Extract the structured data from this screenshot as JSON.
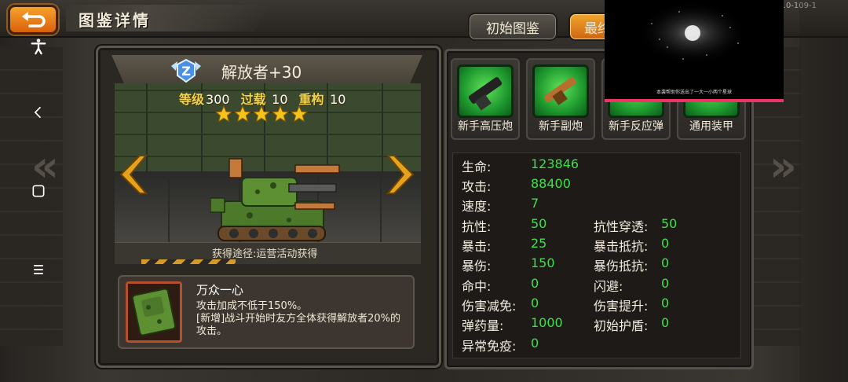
{
  "header": {
    "title": "图鉴详情",
    "btn_initial": "初始图鉴",
    "btn_max": "最终",
    "version": ".0-109-1"
  },
  "unit": {
    "name": "解放者+30",
    "level_label": "等级",
    "level": "300",
    "overload_label": "过载",
    "overload": "10",
    "rebuild_label": "重构",
    "rebuild": "10",
    "stars": 5,
    "source": "获得途径:运营活动获得"
  },
  "skill": {
    "name": "万众一心",
    "desc1": "攻击加成不低于150%。",
    "desc2": "[新增]战斗开始时友方全体获得解放者20%的攻击。"
  },
  "equipment": [
    {
      "label": "新手高压炮"
    },
    {
      "label": "新手副炮"
    },
    {
      "label": "新手反应弹"
    },
    {
      "label": "通用装甲"
    }
  ],
  "stats_left": [
    {
      "label": "生命:",
      "value": "123846"
    },
    {
      "label": "攻击:",
      "value": "88400"
    },
    {
      "label": "速度:",
      "value": "7"
    },
    {
      "label": "抗性:",
      "value": "50"
    },
    {
      "label": "暴击:",
      "value": "25"
    },
    {
      "label": "暴伤:",
      "value": "150"
    },
    {
      "label": "命中:",
      "value": "0"
    },
    {
      "label": "伤害减免:",
      "value": "0"
    },
    {
      "label": "弹药量:",
      "value": "1000"
    },
    {
      "label": "异常免疫:",
      "value": "0"
    }
  ],
  "stats_right": [
    {
      "label": "抗性穿透:",
      "value": "50"
    },
    {
      "label": "暴击抵抗:",
      "value": "0"
    },
    {
      "label": "暴伤抵抗:",
      "value": "0"
    },
    {
      "label": "闪避:",
      "value": "0"
    },
    {
      "label": "伤害提升:",
      "value": "0"
    },
    {
      "label": "初始护盾:",
      "value": "0"
    }
  ],
  "video": {
    "caption": "本袭帮助你送出了一大一小两个星球"
  },
  "colors": {
    "stat_value": "#40e04b",
    "star": "#f3c21b",
    "accent_orange": "#e57a14"
  },
  "icons": [
    "back-icon",
    "z-rank-icon",
    "star-icon",
    "arrow-left-icon",
    "arrow-right-icon",
    "accessibility-icon",
    "nav-back-icon",
    "nav-home-icon",
    "nav-menu-icon"
  ]
}
